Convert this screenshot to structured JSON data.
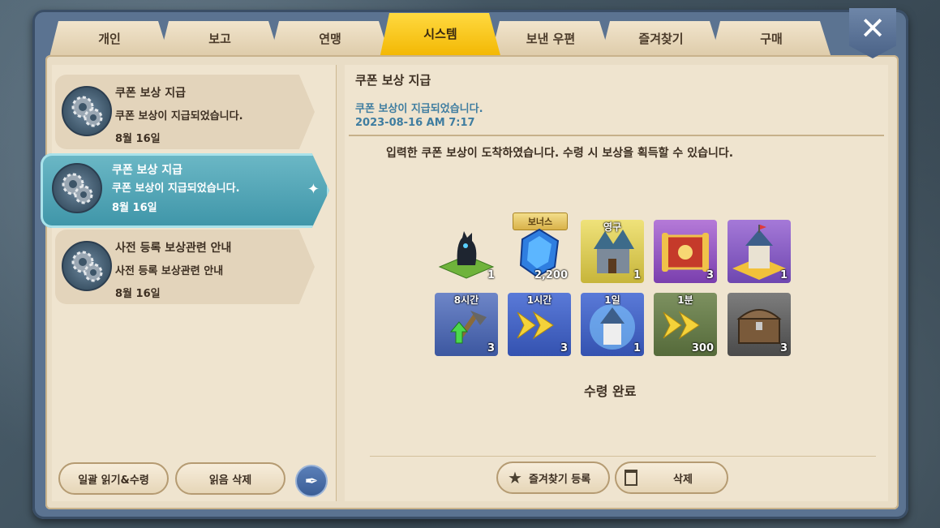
{
  "tabs": [
    {
      "label": "개인"
    },
    {
      "label": "보고"
    },
    {
      "label": "연맹"
    },
    {
      "label": "시스템"
    },
    {
      "label": "보낸 우편"
    },
    {
      "label": "즐겨찾기"
    },
    {
      "label": "구매"
    }
  ],
  "active_tab": "시스템",
  "close_icon": "close-icon",
  "mails": [
    {
      "title": "쿠폰 보상 지급",
      "body": "쿠폰 보상이 지급되었습니다.",
      "date": "8월 16일",
      "selected": false
    },
    {
      "title": "쿠폰 보상 지급",
      "body": "쿠폰 보상이 지급되었습니다.",
      "date": "8월 16일",
      "selected": true
    },
    {
      "title": "사전 등록 보상관련 안내",
      "body": "사전 등록 보상관련 안내",
      "date": "8월 16일",
      "selected": false
    }
  ],
  "left_buttons": {
    "read_all": "일괄 읽기&수령",
    "delete_read": "읽음 삭제"
  },
  "detail": {
    "title": "쿠폰 보상 지급",
    "subtitle": "쿠폰 보상이 지급되었습니다.",
    "timestamp": "2023-08-16 AM 7:17",
    "message": "입력한 쿠폰 보상이 도착하였습니다. 수령 시 보상을 획득할 수 있습니다.",
    "bonus_label": "보너스",
    "items": [
      {
        "name": "dark-creature-tile",
        "qty": "1",
        "tag": ""
      },
      {
        "name": "blue-gem",
        "qty": "2,200",
        "tag": ""
      },
      {
        "name": "castle-skin",
        "qty": "1",
        "tag": "영구"
      },
      {
        "name": "scroll-chest",
        "qty": "3",
        "tag": ""
      },
      {
        "name": "tower-building",
        "qty": "1",
        "tag": ""
      },
      {
        "name": "build-speedup",
        "qty": "3",
        "tag": "8시간"
      },
      {
        "name": "speedup-arrow",
        "qty": "3",
        "tag": "1시간"
      },
      {
        "name": "shield-tower",
        "qty": "1",
        "tag": "1일"
      },
      {
        "name": "speedup-arrow-small",
        "qty": "300",
        "tag": "1분"
      },
      {
        "name": "treasure-chest",
        "qty": "3",
        "tag": ""
      }
    ],
    "status": "수령 완료",
    "favorite_button": "즐겨찾기 등록",
    "delete_button": "삭제"
  },
  "colors": {
    "active_tab": "#f2b600",
    "selected_mail": "#3e95a8",
    "accent_text": "#3f7da0"
  }
}
